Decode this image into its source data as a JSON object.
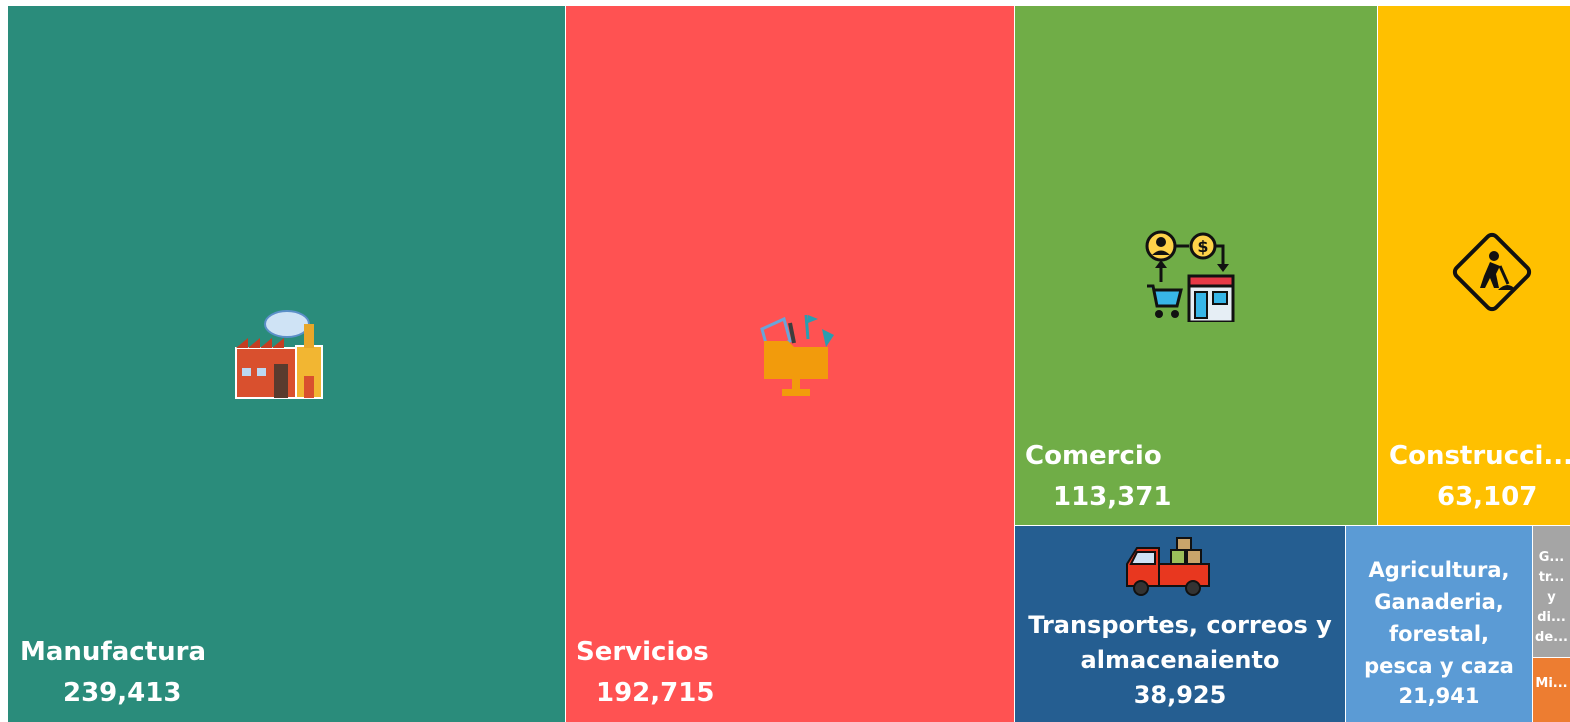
{
  "chart_data": {
    "type": "treemap",
    "items": [
      {
        "name": "Manufactura",
        "value_label": "239,413",
        "value": 239413,
        "color": "#2A8C7B",
        "icon": "factory-icon"
      },
      {
        "name": "Servicios",
        "value_label": "192,715",
        "value": 192715,
        "color": "#FF5252",
        "icon": "services-folder-icon"
      },
      {
        "name": "Comercio",
        "value_label": "113,371",
        "value": 113371,
        "color": "#70AD47",
        "icon": "commerce-store-icon"
      },
      {
        "name": "Construcci...",
        "value_label": "63,107",
        "value": 63107,
        "color": "#FFC000",
        "icon": "construction-sign-icon"
      },
      {
        "name": "Transportes, correos y almacenaiento",
        "value_label": "38,925",
        "value": 38925,
        "color": "#255E91",
        "icon": "truck-icon"
      },
      {
        "name": "Agricultura, Ganaderia, forestal, pesca y caza",
        "value_label": "21,941",
        "value": 21941,
        "color": "#5B9BD5",
        "icon": ""
      },
      {
        "name": "G... tr... y di... de...",
        "value_label": "",
        "value": null,
        "color": "#A5A5A5",
        "icon": ""
      },
      {
        "name": "Mi...",
        "value_label": "",
        "value": null,
        "color": "#ED7D31",
        "icon": ""
      }
    ]
  }
}
